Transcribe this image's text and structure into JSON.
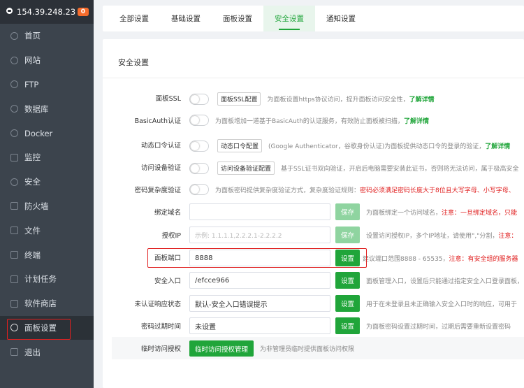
{
  "sidebar": {
    "server_ip": "154.39.248.23",
    "badge": "0",
    "items": [
      {
        "label": "首页",
        "icon": "home-icon"
      },
      {
        "label": "网站",
        "icon": "globe-icon"
      },
      {
        "label": "FTP",
        "icon": "ftp-icon"
      },
      {
        "label": "数据库",
        "icon": "database-icon"
      },
      {
        "label": "Docker",
        "icon": "docker-icon"
      },
      {
        "label": "监控",
        "icon": "monitor-icon"
      },
      {
        "label": "安全",
        "icon": "shield-check-icon"
      },
      {
        "label": "防火墙",
        "icon": "firewall-icon"
      },
      {
        "label": "文件",
        "icon": "folder-icon"
      },
      {
        "label": "终端",
        "icon": "terminal-icon"
      },
      {
        "label": "计划任务",
        "icon": "calendar-icon"
      },
      {
        "label": "软件商店",
        "icon": "apps-icon"
      },
      {
        "label": "面板设置",
        "icon": "gear-icon"
      },
      {
        "label": "退出",
        "icon": "logout-icon"
      }
    ],
    "active_index": 12
  },
  "tabs": [
    "全部设置",
    "基础设置",
    "面板设置",
    "安全设置",
    "通知设置"
  ],
  "active_tab": 3,
  "card_title": "安全设置",
  "rows": {
    "ssl": {
      "label": "面板SSL",
      "btn": "面板SSL配置",
      "desc": "为面板设置https协议访问，提升面板访问安全性，",
      "link": "了解详情"
    },
    "basicauth": {
      "label": "BasicAuth认证",
      "desc": "为面板增加一道基于BasicAuth的认证服务，有效防止面板被扫描，",
      "link": "了解详情"
    },
    "otp": {
      "label": "动态口令认证",
      "btn": "动态口令配置",
      "desc": "(Google Authenticator，谷歌身份认证)为面板提供动态口令的登录的验证，",
      "link": "了解详情"
    },
    "device": {
      "label": "访问设备验证",
      "btn": "访问设备验证配置",
      "desc": "基于SSL证书双向验证，开启后电脑需要安装此证书，否则将无法访问，属于极高安全"
    },
    "pwd_complex": {
      "label": "密码复杂度验证",
      "desc": "为面板密码提供复杂度验证方式，复杂度验证规则：",
      "warn": "密码必须满足密码长度大于8位且大写字母、小写字母、"
    },
    "domain": {
      "label": "绑定域名",
      "value": "",
      "btn": "保存",
      "desc": "为面板绑定一个访问域名，",
      "warn": "注意：一旦绑定域名，只能"
    },
    "auth_ip": {
      "label": "授权IP",
      "placeholder": "示例: 1.1.1.1,2.2.2.1-2.2.2.2",
      "btn": "保存",
      "desc": "设置访问授权IP，多个IP地址，请使用\",\"分割，",
      "warn": "注意："
    },
    "port": {
      "label": "面板端口",
      "value": "8888",
      "btn": "设置",
      "desc": "建议端口范围8888 - 65535，",
      "warn": "注意：有安全组的服务器"
    },
    "entry": {
      "label": "安全入口",
      "value": "/efcce966",
      "btn": "设置",
      "desc": "面板管理入口，设置后只能通过指定安全入口登录面板，"
    },
    "unauth": {
      "label": "未认证响应状态",
      "value": "默认-安全入口错误提示",
      "btn": "设置",
      "desc": "用于在未登录且未正确输入安全入口时的响应，可用于"
    },
    "pwd_expire": {
      "label": "密码过期时间",
      "value": "未设置",
      "btn": "设置",
      "desc": "为面板密码设置过期时间，过期后需要重新设置密码"
    },
    "temp_auth": {
      "label": "临时访问授权",
      "btn": "临时访问授权管理",
      "desc": "为非管理员临时提供面板访问权限"
    }
  },
  "colors": {
    "accent": "#20a53a",
    "warn": "#e02020",
    "sidebar": "#3c444d"
  }
}
